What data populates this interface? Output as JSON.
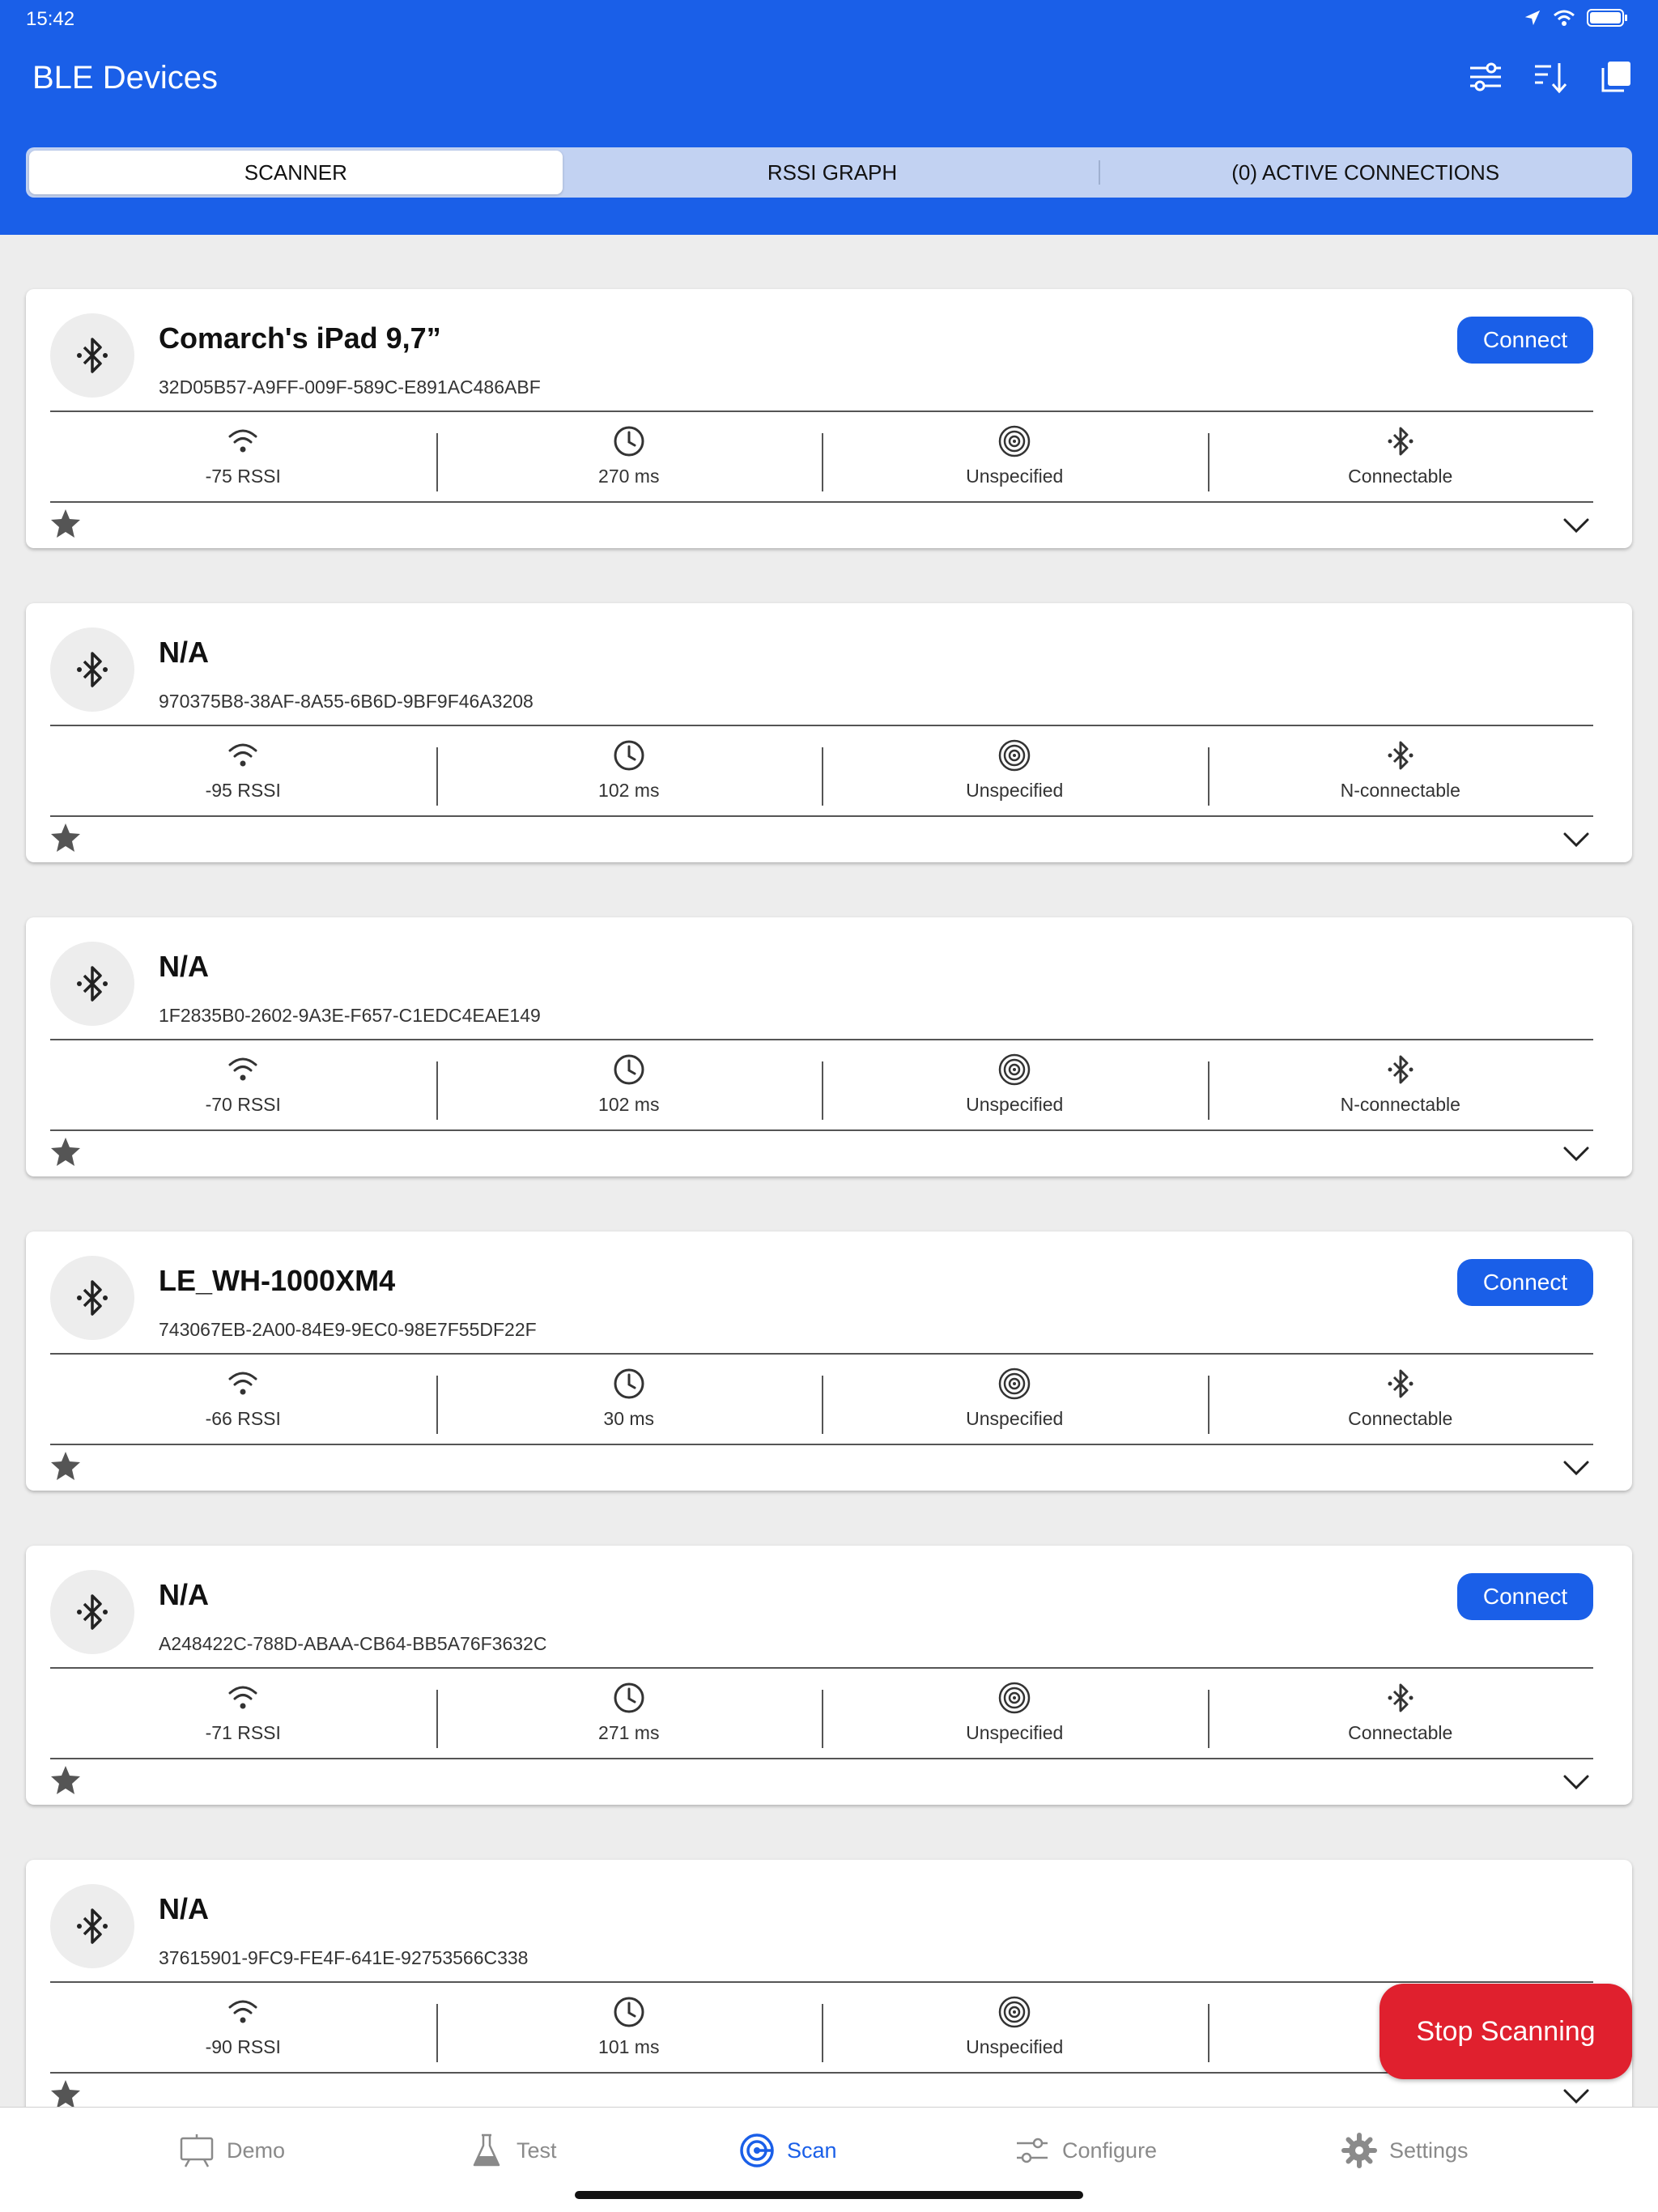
{
  "status_bar": {
    "time": "15:42"
  },
  "header": {
    "title": "BLE Devices",
    "actions": [
      {
        "name": "filter",
        "icon": "sliders-icon"
      },
      {
        "name": "sort",
        "icon": "sort-icon"
      },
      {
        "name": "log",
        "icon": "copy-icon"
      }
    ]
  },
  "tabs": [
    {
      "label": "SCANNER",
      "active": true
    },
    {
      "label": "RSSI GRAPH",
      "active": false
    },
    {
      "label": "(0) ACTIVE CONNECTIONS",
      "active": false
    }
  ],
  "devices": [
    {
      "name": "Comarch's iPad 9,7”",
      "uuid": "32D05B57-A9FF-009F-589C-E891AC486ABF",
      "rssi": "-75 RSSI",
      "interval": "270 ms",
      "beacon": "Unspecified",
      "connectable": "Connectable",
      "show_connect": true
    },
    {
      "name": "N/A",
      "uuid": "970375B8-38AF-8A55-6B6D-9BF9F46A3208",
      "rssi": "-95 RSSI",
      "interval": "102 ms",
      "beacon": "Unspecified",
      "connectable": "N-connectable",
      "show_connect": false
    },
    {
      "name": "N/A",
      "uuid": "1F2835B0-2602-9A3E-F657-C1EDC4EAE149",
      "rssi": "-70 RSSI",
      "interval": "102 ms",
      "beacon": "Unspecified",
      "connectable": "N-connectable",
      "show_connect": false
    },
    {
      "name": "LE_WH-1000XM4",
      "uuid": "743067EB-2A00-84E9-9EC0-98E7F55DF22F",
      "rssi": "-66 RSSI",
      "interval": "30 ms",
      "beacon": "Unspecified",
      "connectable": "Connectable",
      "show_connect": true
    },
    {
      "name": "N/A",
      "uuid": "A248422C-788D-ABAA-CB64-BB5A76F3632C",
      "rssi": "-71 RSSI",
      "interval": "271 ms",
      "beacon": "Unspecified",
      "connectable": "Connectable",
      "show_connect": true
    },
    {
      "name": "N/A",
      "uuid": "37615901-9FC9-FE4F-641E-92753566C338",
      "rssi": "-90 RSSI",
      "interval": "101 ms",
      "beacon": "Unspecified",
      "connectable": "N-co",
      "show_connect": false
    }
  ],
  "connect_label": "Connect",
  "stop_scanning_label": "Stop Scanning",
  "bottom_tabs": [
    {
      "label": "Demo",
      "icon": "presentation-icon",
      "active": false
    },
    {
      "label": "Test",
      "icon": "flask-icon",
      "active": false
    },
    {
      "label": "Scan",
      "icon": "scan-icon",
      "active": true
    },
    {
      "label": "Configure",
      "icon": "sliders-icon",
      "active": false
    },
    {
      "label": "Settings",
      "icon": "gear-icon",
      "active": false
    }
  ],
  "colors": {
    "brand": "#1a5fe8",
    "stop": "#e0202e",
    "background": "#ededed"
  }
}
